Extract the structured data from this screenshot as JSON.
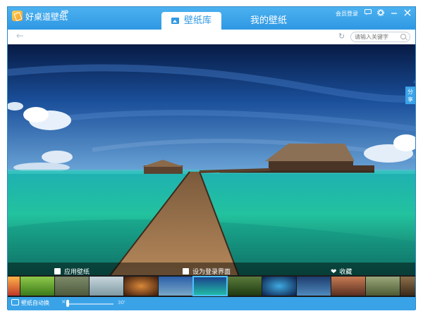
{
  "app": {
    "name": "好桌道壁纸",
    "badge": "HD"
  },
  "tabs": [
    {
      "label": "壁纸库",
      "active": true
    },
    {
      "label": "我的壁纸",
      "active": false
    }
  ],
  "header": {
    "member_login": "会员登录"
  },
  "icons": {
    "logo": "app-logo-icon",
    "message": "message-icon",
    "settings": "gear-icon",
    "minimize": "minimize-icon",
    "close": "close-icon",
    "back": "back-arrow-icon",
    "refresh": "refresh-icon",
    "search": "search-icon"
  },
  "search": {
    "placeholder": "请输入关键字"
  },
  "share": {
    "label": "分享"
  },
  "actions": {
    "apply": "应用壁纸",
    "login_bg": "设为登录界面",
    "favorite": "收藏"
  },
  "status": {
    "auto_change": "壁纸自动换",
    "interval": "30'"
  },
  "colors": {
    "accent": "#3aa3e8",
    "accent_dark": "#2f98e3",
    "selected_thumb": "#4cc0ff"
  }
}
